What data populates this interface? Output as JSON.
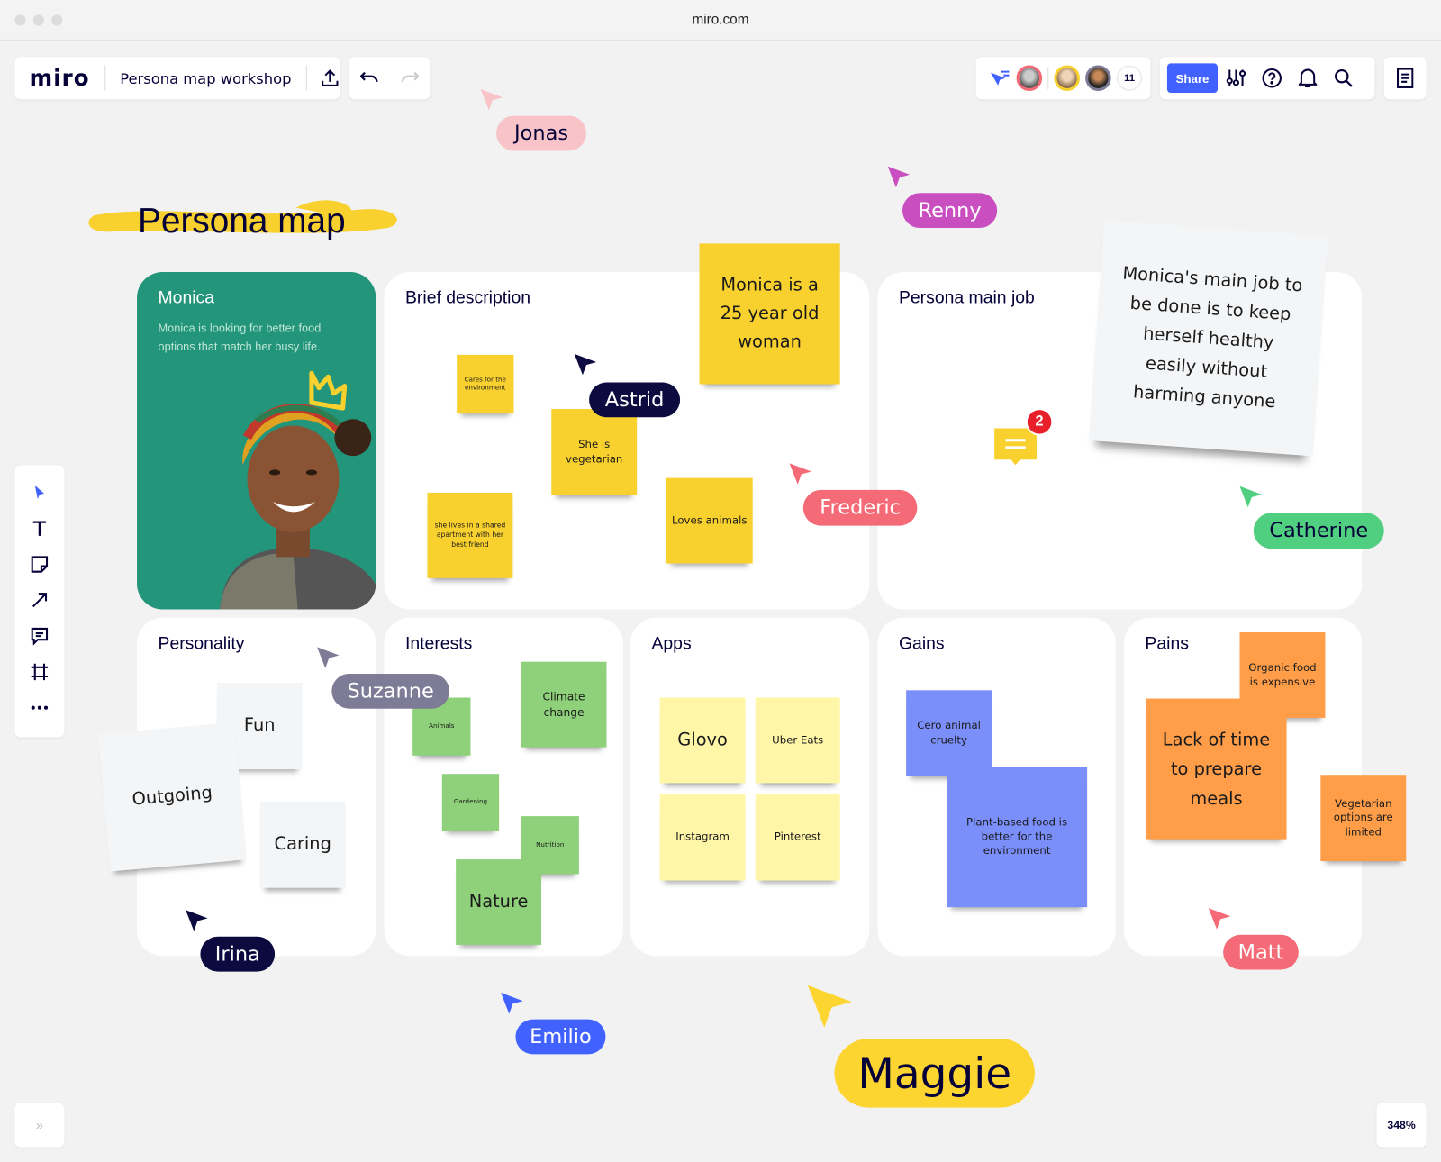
{
  "browser": {
    "url": "miro.com"
  },
  "header": {
    "logo": "miro",
    "board_name": "Persona map workshop",
    "collaborator_count": "11",
    "share_label": "Share"
  },
  "board": {
    "title": "Persona map",
    "persona": {
      "name": "Monica",
      "description": "Monica is looking for better food options that match her busy life."
    },
    "brief": {
      "title": "Brief description",
      "notes": [
        "Cares for the environment",
        "She is vegetarian",
        "she lives in a shared apartment with her best friend",
        "Loves animals",
        "Monica is a 25 year old woman"
      ]
    },
    "main_job": {
      "title": "Persona main job",
      "note": "Monica's main job to be done is to keep herself healthy easily without harming anyone",
      "comment_count": "2"
    },
    "personality": {
      "title": "Personality",
      "notes": [
        "Fun",
        "Outgoing",
        "Caring"
      ]
    },
    "interests": {
      "title": "Interests",
      "notes": [
        "Animals",
        "Climate change",
        "Gardening",
        "Nutrition",
        "Nature"
      ]
    },
    "apps": {
      "title": "Apps",
      "notes": [
        "Glovo",
        "Uber Eats",
        "Instagram",
        "Pinterest"
      ]
    },
    "gains": {
      "title": "Gains",
      "notes": [
        "Cero animal cruelty",
        "Plant-based food is better for the environment"
      ]
    },
    "pains": {
      "title": "Pains",
      "notes": [
        "Organic food is expensive",
        "Lack of time to prepare meals",
        "Vegetarian options are limited"
      ]
    }
  },
  "cursors": [
    {
      "name": "Jonas",
      "color": "#f8c4c8"
    },
    {
      "name": "Renny",
      "color": "#c94fc0"
    },
    {
      "name": "Astrid",
      "color": "#0c0a3e"
    },
    {
      "name": "Frederic",
      "color": "#f46a76"
    },
    {
      "name": "Catherine",
      "color": "#4fcf7f"
    },
    {
      "name": "Suzanne",
      "color": "#7d7b95"
    },
    {
      "name": "Irina",
      "color": "#0c0a3e"
    },
    {
      "name": "Emilio",
      "color": "#4262ff"
    },
    {
      "name": "Maggie",
      "color": "#fdd530"
    },
    {
      "name": "Matt",
      "color": "#f46a76"
    }
  ],
  "footer": {
    "zoom": "348%",
    "expand": "»"
  },
  "colors": {
    "accent": "#4262ff",
    "persona_card": "#23957a"
  }
}
